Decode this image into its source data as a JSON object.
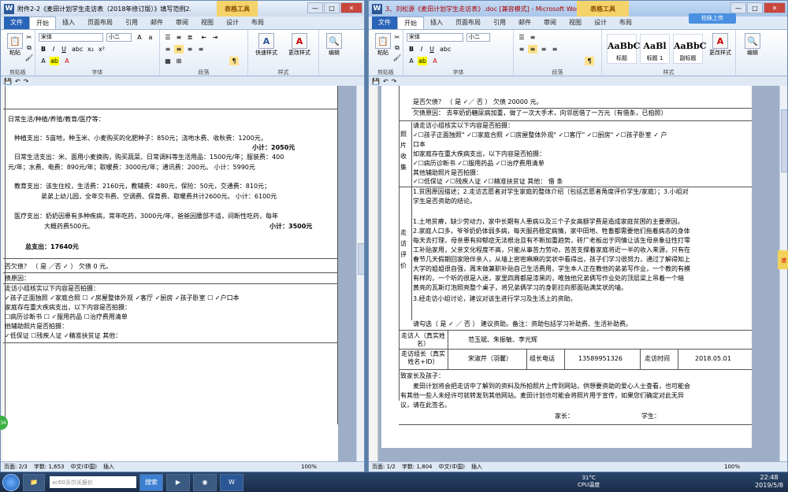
{
  "left": {
    "title": "附件2-2《麦田计划学生走访表（2018年修订版）》填写范例2.doc [兼容...",
    "context_tab": "表格工具",
    "tabs": [
      "文件",
      "开始",
      "插入",
      "页面布局",
      "引用",
      "邮件",
      "审阅",
      "视图",
      "设计",
      "布局"
    ],
    "font_name": "宋体",
    "font_size": "小二",
    "group_labels": {
      "clipboard": "剪贴板",
      "font": "字体",
      "paragraph": "段落",
      "styles": "样式",
      "editing": "编辑"
    },
    "btn_paste": "粘贴",
    "btn_quick_styles": "快速样式",
    "btn_change_styles": "更改样式",
    "btn_edit": "编辑",
    "doc_lines": [
      "日常生活/种植/养殖/教育/医疗等：",
      "种植支出：5亩地，种玉米、小麦购买的化肥种子：850元；浇地水费、收秋费：1200元，",
      "小计：2050元",
      "日常生活支出：米、面用小麦换购，购买蔬菜、日常调料等生活用品：1500元/年；服装费：400",
      "元/年；水费、电费：890元/年；取暖费：3000元/年；通讯费：200元。 小计：5990元",
      "教育支出：该生住校，生活费：2160元，教辅费：480元，保险：50元，交通费：810元；",
      "弟弟上幼儿园，全年交书费、空调费、保育费、取暖费共计2600元。 小计：6100元",
      "医疗支出：奶奶因患有多种疾病，常年吃药，3000元/年，爸爸因腰部不适，间断性吃药，每年",
      "大概药费500元。",
      "小计：3500元",
      "总支出：17640元",
      "否欠债？ （ 是 ／否 ✓ ） 欠债     0      元。",
      "债原因：",
      "走访小组核实以下内容是否拍摄：",
      "✓孩子正面独照 ✓家庭合照 ☐ ✓房屋整体外观 ✓客厅 ✓厨房 ✓孩子卧室 ☐ ✓户口本",
      "家庭存在重大疾病支出，以下内容是否拍摄：",
      "☐病历诊断书     ☐ ✓服用药品 ☐治疗费用清单",
      "他辅助照片是否拍摄：",
      "✓低保证     ☐残疾人证    ✓精准扶贫证   其他："
    ],
    "status": [
      "页面: 2/3",
      "字数: 1,653",
      "中文(中国)",
      "插入"
    ],
    "zoom": "100%"
  },
  "right": {
    "title": "3、刘松源《麦田计划学生走访表》.doc [兼容模式] - Microsoft Word...",
    "context_tab": "表格工具",
    "cloud_btn": "拍抹上传",
    "tabs": [
      "文件",
      "开始",
      "插入",
      "页面布局",
      "引用",
      "邮件",
      "审阅",
      "视图",
      "设计",
      "布局"
    ],
    "font_name": "宋体",
    "font_size": "小二",
    "group_labels": {
      "clipboard": "剪贴板",
      "font": "字体",
      "paragraph": "段落",
      "styles": "样式"
    },
    "btn_paste": "粘贴",
    "styles": [
      {
        "sample": "AaBbC",
        "name": "标题"
      },
      {
        "sample": "AaBl",
        "name": "标题 1"
      },
      {
        "sample": "AaBbC",
        "name": "副标题"
      }
    ],
    "btn_change_styles": "更改样式",
    "btn_edit": "编辑",
    "debt_line": "是否欠债？ （ 是 ✓／ 否 ） 欠债     20000     元。",
    "debt_reason": "欠债原因：  去年奶奶糖尿病加重，做了一次大手术，向邻居借了一万元（有借条，已拍照）",
    "photo_label": "照片收集",
    "photo_lines": [
      "请走访小组核实以下内容是否拍摄：",
      "✓☐孩子正面独照\" ✓☐家庭合照  ✓☐房屋整体外观\" ✓☐客厅\" ✓☐厨房\" ✓☐孩子卧室 ✓ 户",
      "口本",
      "如家庭存在重大疾病支出，以下内容是否拍摄：",
      "✓☐病历诊断书    ✓☐服用药品   ✓☐治疗费用清单",
      "其他辅助照片是否拍摄：",
      "✓☐低保证      ✓☐残疾人证     ✓☐精准扶贫证    其他：      借  条"
    ],
    "eval_label": "走访评价",
    "eval_lines": [
      "1.贫困原因描述；2.走访志愿者对学生家庭的整体介绍（包括志愿者角度评价学生/家庭）；3.小组对",
      "学生是否资助的结论。",
      "1.土地贫瘠，缺少劳动力，家中长期有人患病以及三个子女高额学费是造成家庭贫困的主要原因。",
      "2.家庭人口多，爷爷奶奶体弱多病，每天服药稳定病情，家中田地、牲畜都需要他们拖着病态的身体",
      "每天去打理，母亲患有抑郁症无法根治且有不断加重趋势，砖厂老板出于同情让该生母亲象征性打零",
      "工补贴家用，父亲文化程度不高，只能从事苦力劳动，苦苦支撑着家庭将近一半的收入来源，只有在",
      "春节几天假期回家陪伴亲人，从墙上密密麻麻的奖状中看得出，孩子们学习很努力，通过了解得知上",
      "大学的姐姐很自强，周末做兼职补贴自己生活费用，学生本人正在教他的弟弟写作业，一个教的有模",
      "有样的，一个听的很是入迷，家里四周都是漆黑的，唯独他兄弟俩写作业处的顶层梁上吊着一个暗",
      "黄亮的瓦斯灯泡照亮整个桌子，将兄弟俩学习的身影拉向那面贴满奖状的墙。",
      "3.经走访小组讨论，建议对该生进行学习及生活上的资助。"
    ],
    "check_line": "请勾选（ 是 ✓ ／ 否 ） 建议资助。备注：资助包括学习补助费、生活补助费。",
    "visitor_label": "走访人（真实姓名）",
    "visitor_value": "范玉斌、朱振敏、李光辉",
    "leader_label": "走访组长（真实姓名+ID）",
    "leader_value": "宋淑芹（羽馨）",
    "phone_label": "组长电话",
    "phone_value": "13589951326",
    "time_label": "走访时间",
    "time_value": "2018.05.01",
    "parents_title": "致家长及孩子：",
    "parents_lines": [
      "麦田计划将会把走访中了解到的资料及所拍照片上传到网站，供想要资助的爱心人士查看，也可能会",
      "有其他一些人未经许可就转发到其他网站。麦田计划也可能会将照片用于宣传，如果您们确定对此无异",
      "议，请在此签名。"
    ],
    "sign_parent": "家长：",
    "sign_student": "学生：",
    "status": [
      "页面: 1/2",
      "字数: 1,804",
      "中文(中国)",
      "插入"
    ],
    "zoom": "100%"
  },
  "taskbar": {
    "search_placeholder": "xc60沃尔沃报价",
    "search_btn": "搜索",
    "temp": "31°C",
    "cpu": "CPU温度",
    "time": "22:48",
    "date": "2019/5/8",
    "side_badge": "度",
    "green_badge": "34"
  }
}
